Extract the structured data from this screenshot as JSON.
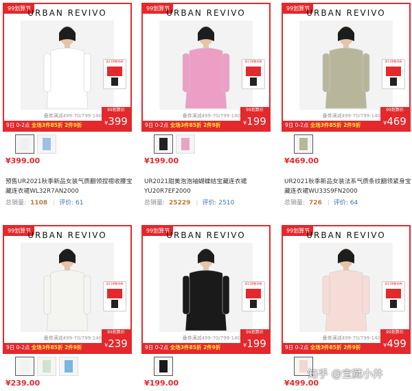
{
  "brand": "URBAN REVIVO",
  "badge": "99划算节",
  "promo": {
    "coupon_line": "叠券满减499-70/799-140",
    "bar_prefix": "9日 0-2点",
    "bar_highlight": "全场3件85折 2件9折",
    "price_label": "99划算价",
    "currency": "¥"
  },
  "sticker": {
    "text": "双11预售领券"
  },
  "products": [
    {
      "promo_price": "399",
      "price": "¥399.00",
      "title": "预售UR2021秋季新品女装气质翻领捏褶收腰宝藏连衣裙WL32R7AN2000",
      "sales_label": "总销量:",
      "sales": "1108",
      "reviews": "评价: 61",
      "colors": [
        "#f0f0f0",
        "#9ec0e8"
      ],
      "dress": "#ffffff"
    },
    {
      "promo_price": "199",
      "price": "¥199.00",
      "title": "UR2021甜美泡泡袖蝴蝶结宝藏连衣裙YU20R7EF2000",
      "sales_label": "总销量:",
      "sales": "25229",
      "reviews": "评价: 2510",
      "colors": [
        "#222222",
        "#e9a4c4"
      ],
      "dress": "#ec9ec4"
    },
    {
      "promo_price": "469",
      "price": "¥469.00",
      "title": "UR2021秋季新品女装法系气质条纹翻领紧身宝藏连衣裙WU33S9FN2000",
      "sales_label": "总销量:",
      "sales": "726",
      "reviews": "评价: 64",
      "colors": [
        "#b9b79a"
      ],
      "dress": "#b8b69a"
    },
    {
      "promo_price": "239",
      "price": "¥239.00",
      "title": "",
      "colors": [
        "#f2f2ef",
        "#cfe3cc",
        "#7ab6e0"
      ],
      "dress": "#f4f4f0"
    },
    {
      "promo_price": "199",
      "price": "¥199.00",
      "title": "",
      "colors": [
        "#1a1a1a"
      ],
      "dress": "#1a1a1a"
    },
    {
      "promo_price": "499",
      "price": "¥499.00",
      "title": "",
      "colors": [
        "#f2d8d2"
      ],
      "dress": "#f6dcd6"
    }
  ],
  "watermark": "知乎 @宝藏小井"
}
